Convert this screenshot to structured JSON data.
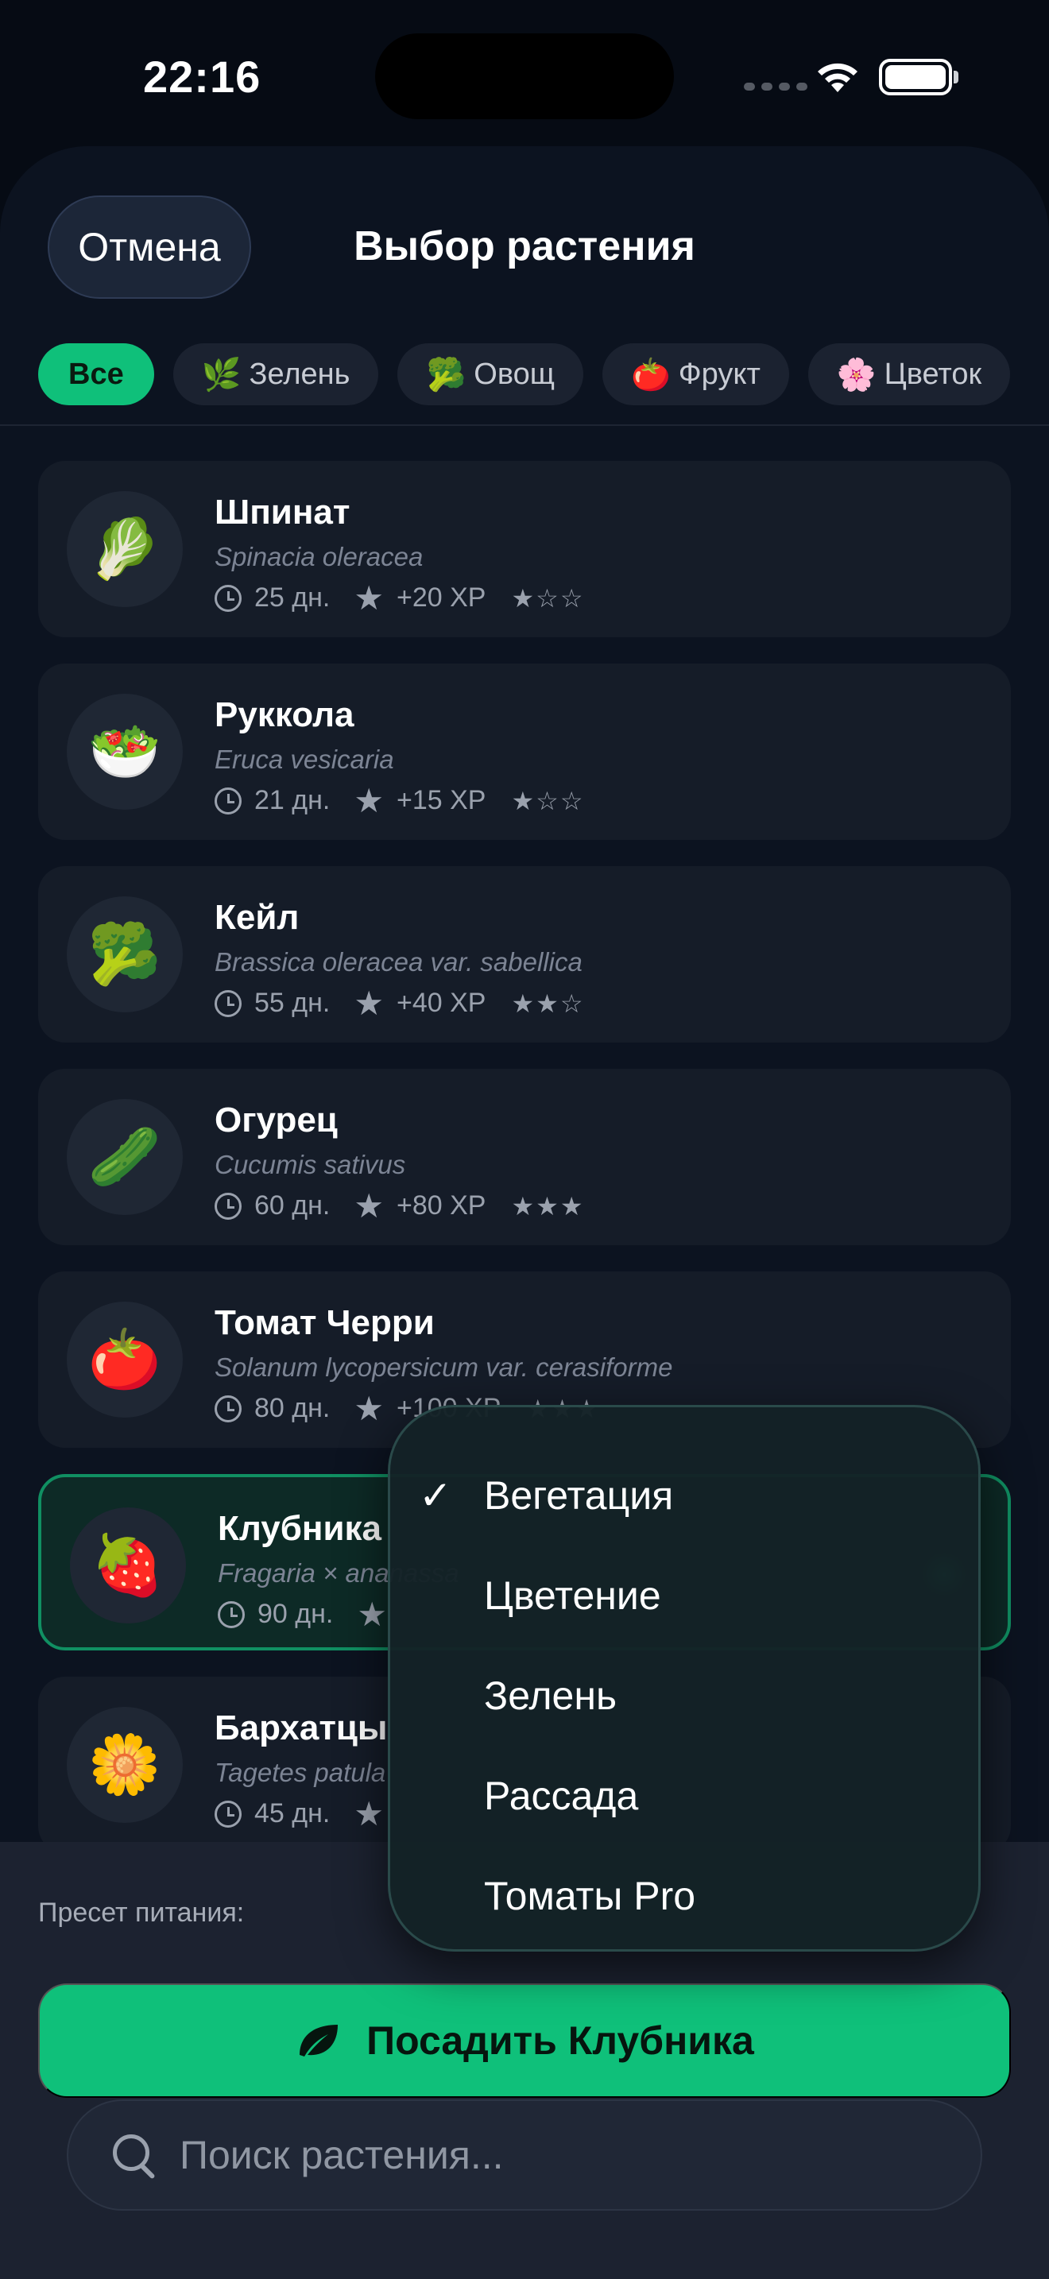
{
  "status": {
    "time": "22:16"
  },
  "header": {
    "cancel_label": "Отмена",
    "title": "Выбор растения"
  },
  "filters": [
    {
      "label": "Все",
      "emoji": "",
      "active": true
    },
    {
      "label": "Зелень",
      "emoji": "🌿",
      "active": false
    },
    {
      "label": "Овощ",
      "emoji": "🥦",
      "active": false
    },
    {
      "label": "Фрукт",
      "emoji": "🍅",
      "active": false
    },
    {
      "label": "Цветок",
      "emoji": "🌸",
      "active": false
    }
  ],
  "plants": [
    {
      "name": "Шпинат",
      "latin": "Spinacia oleracea",
      "days": "25 дн.",
      "xp": "+20 XP",
      "difficulty": "★☆☆",
      "emoji": "🥬",
      "selected": false
    },
    {
      "name": "Руккола",
      "latin": "Eruca vesicaria",
      "days": "21 дн.",
      "xp": "+15 XP",
      "difficulty": "★☆☆",
      "emoji": "🥗",
      "selected": false
    },
    {
      "name": "Кейл",
      "latin": "Brassica oleracea var. sabellica",
      "days": "55 дн.",
      "xp": "+40 XP",
      "difficulty": "★★☆",
      "emoji": "🥦",
      "selected": false
    },
    {
      "name": "Огурец",
      "latin": "Cucumis sativus",
      "days": "60 дн.",
      "xp": "+80 XP",
      "difficulty": "★★★",
      "emoji": "🥒",
      "selected": false
    },
    {
      "name": "Томат Черри",
      "latin": "Solanum lycopersicum var. cerasiforme",
      "days": "80 дн.",
      "xp": "+100 XP",
      "difficulty": "★★★",
      "emoji": "🍅",
      "selected": false
    },
    {
      "name": "Клубника",
      "latin": "Fragaria × ananassa",
      "days": "90 дн.",
      "xp": "",
      "difficulty": "",
      "emoji": "🍓",
      "selected": true
    },
    {
      "name": "Бархатцы",
      "latin": "Tagetes patula",
      "days": "45 дн.",
      "xp": "",
      "difficulty": "",
      "emoji": "🌼",
      "selected": false
    }
  ],
  "preset": {
    "label": "Пресет питания:",
    "options": [
      "Вегетация",
      "Цветение",
      "Зелень",
      "Рассада",
      "Томаты Pro"
    ],
    "selected": "Вегетация"
  },
  "plant_button": {
    "label": "Посадить Клубника"
  },
  "search": {
    "placeholder": "Поиск растения..."
  },
  "colors": {
    "accent": "#0fc07a",
    "background": "#0c1320",
    "card": "#151c28"
  }
}
